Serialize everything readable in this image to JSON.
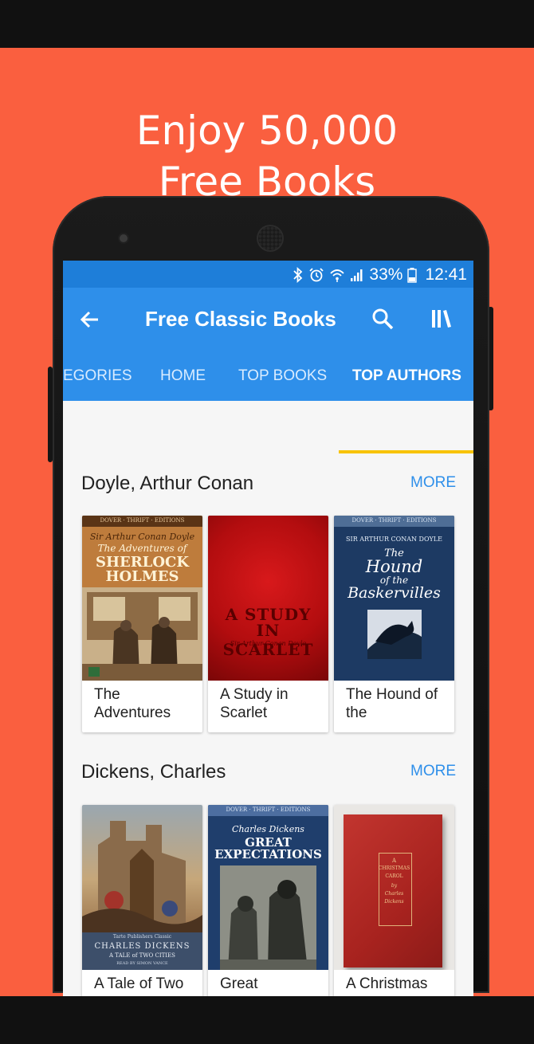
{
  "promo": {
    "headline_line1": "Enjoy 50,000",
    "headline_line2": "Free Books",
    "background": "#FA5F3F"
  },
  "status_bar": {
    "battery": "33%",
    "time": "12:41",
    "icons": [
      "bluetooth-icon",
      "alarm-icon",
      "wifi-icon",
      "signal-icon",
      "battery-icon"
    ]
  },
  "app_bar": {
    "title": "Free Classic Books",
    "back_icon": "arrow-left-icon",
    "search_icon": "search-icon",
    "library_icon": "library-icon",
    "color": "#2E8FEA"
  },
  "tabs": [
    {
      "label": "EGORIES"
    },
    {
      "label": "HOME"
    },
    {
      "label": "TOP BOOKS"
    },
    {
      "label": "TOP AUTHORS",
      "active": true
    }
  ],
  "sections": [
    {
      "author": "Doyle, Arthur Conan",
      "more": "MORE",
      "books": [
        {
          "title": "The Adventures",
          "cover_lines": [
            "DOVER · THRIFT · EDITIONS",
            "Sir Arthur Conan Doyle",
            "The Adventures of",
            "SHERLOCK",
            "HOLMES"
          ]
        },
        {
          "title": "A Study in Scarlet",
          "cover_lines": [
            "A STUDY",
            "IN SCARLET",
            "Sir Arthur Conan Doyle"
          ]
        },
        {
          "title": "The Hound of the",
          "cover_lines": [
            "DOVER · THRIFT · EDITIONS",
            "SIR ARTHUR CONAN DOYLE",
            "The",
            "Hound",
            "of the",
            "Baskervilles"
          ]
        }
      ]
    },
    {
      "author": "Dickens, Charles",
      "more": "MORE",
      "books": [
        {
          "title": "A Tale of Two",
          "cover_lines": [
            "Tarte Publishers Classic",
            "CHARLES DICKENS",
            "A TALE of TWO CITIES",
            "READ BY SIMON VANCE"
          ]
        },
        {
          "title": "Great",
          "cover_lines": [
            "DOVER · THRIFT · EDITIONS",
            "Charles Dickens",
            "GREAT",
            "EXPECTATIONS"
          ]
        },
        {
          "title": "A Christmas",
          "cover_lines": [
            "A",
            "CHRISTMAS",
            "CAROL",
            "by",
            "Charles",
            "Dickens"
          ]
        }
      ]
    }
  ]
}
